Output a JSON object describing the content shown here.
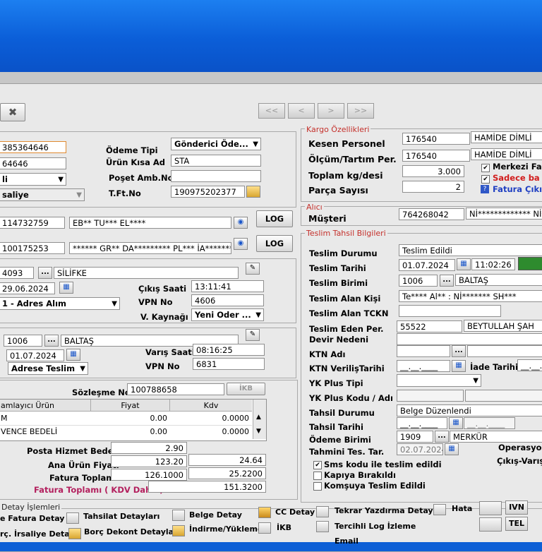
{
  "toolbar": {
    "close": "✖",
    "nav": [
      "<<",
      "<",
      ">",
      ">>"
    ]
  },
  "left": {
    "code_top": "385364646",
    "code2": "64646",
    "combo_li": "li",
    "combo_saliye": "saliye",
    "odeme_tipi_label": "Ödeme Tipi",
    "odeme_tipi_value": "Gönderici Öde...",
    "urun_kisa_ad_label": "Ürün Kısa Ad",
    "urun_kisa_ad_value": "STA",
    "poset_label": "Poşet Amb.No",
    "poset_value": "",
    "tft_label": "T.Ft.No",
    "tft_value": "190975202377",
    "sender_id": "114732759",
    "sender_name": "EB** TU*** EL****",
    "log1": "LOG",
    "recv_id": "100175253",
    "recv_name": "****** GR** DA********* PL*** İA********",
    "log2": "LOG",
    "origin_code": "4093",
    "origin_name": "SİLİFKE",
    "origin_date": "29.06.2024",
    "adres_alim": "1 - Adres Alım",
    "cikis_saati_label": "Çıkış Saati",
    "cikis_saati": "13:11:41",
    "vpn1_label": "VPN No",
    "vpn1": "4606",
    "vkaynagi_label": "V. Kaynağı",
    "vkaynagi": "Yeni Oder ...",
    "dest_code": "1006",
    "dest_name": "BALTAŞ",
    "dest_date": "01.07.2024",
    "varis_saati_label": "Varış Saati",
    "varis_saati": "08:16:25",
    "adrese_teslim": "Adrese Teslim",
    "vpn2_label": "VPN No",
    "vpn2": "6831",
    "sozlesme_label": "Sözleşme No",
    "sozlesme": "100788658",
    "ikb": "İKB",
    "table_headers": [
      "amlayıcı Ürün",
      "Fiyat",
      "Kdv"
    ],
    "rows": [
      {
        "name": "M",
        "fiyat": "0.00",
        "kdv": "0.0000"
      },
      {
        "name": "VENCE BEDELİ",
        "fiyat": "0.00",
        "kdv": "0.0000"
      }
    ],
    "posta_label": "Posta Hizmet Bedeli",
    "posta": "2.90",
    "ana_label": "Ana Ürün Fiyatı",
    "ana_fiyat": "123.20",
    "ana_kdv": "24.64",
    "fatura_label": "Fatura Toplamı",
    "fatura": "126.1000",
    "fatura_kdv": "25.2200",
    "fatura_kdv_label": "Fatura Toplamı ( KDV Dahil )",
    "fatura_kdv_total": "151.3200"
  },
  "kargo": {
    "title": "Kargo Özellikleri",
    "kesen_label": "Kesen Personel",
    "kesen_id": "176540",
    "kesen_name": "HAMİDE  DİMLİ",
    "olcum_label": "Ölçüm/Tartım Per.",
    "olcum_id": "176540",
    "olcum_name": "HAMİDE  DİMLİ",
    "toplam_label": "Toplam kg/desi",
    "toplam": "3.000",
    "parca_label": "Parça Sayısı",
    "parca": "2",
    "merkezi": "Merkezi Fa",
    "sadece": "Sadece ba",
    "fatura_cikis": "Fatura Çıkış"
  },
  "alici": {
    "title": "Alıcı",
    "musteri_label": "Müşteri",
    "musteri": "764268042",
    "name": "Nİ*************  Nİ**"
  },
  "teslim": {
    "title": "Teslim Tahsil Bilgileri",
    "durum_label": "Teslim Durumu",
    "durum": "Teslim Edildi",
    "tarih_label": "Teslim Tarihi",
    "tarih": "01.07.2024",
    "saat": "11:02:26",
    "birim_label": "Teslim Birimi",
    "birim_code": "1006",
    "birim_name": "BALTAŞ",
    "alan_label": "Teslim Alan Kişi",
    "alan": "Te**** Al** : Nİ******* SH***",
    "tckn_label": "Teslim Alan TCKN",
    "eden_label": "Teslim Eden Per.",
    "eden_id": "55522",
    "eden_name": "BEYTULLAH  ŞAH",
    "devir_label": "Devir Nedeni",
    "ktn_label": "KTN Adı",
    "ktn_tarih_label": "KTN VerilişTarihi",
    "iade_label": "İade Tarihi",
    "date_mask": "__.__.____",
    "yk_tipi_label": "YK Plus Tipi",
    "yk_kodu_label": "YK Plus Kodu / Adı",
    "tahsil_durum_label": "Tahsil Durumu",
    "tahsil_durum": "Belge Düzenlendi",
    "tahsil_tarih_label": "Tahsil Tarihi",
    "odeme_birimi_label": "Ödeme Birimi",
    "odeme_birimi_code": "1909",
    "odeme_birimi_name": "MERKÜR",
    "tahmini_label": "Tahmini Tes. Tar.",
    "tahmini": "02.07.2024",
    "operasyon": "Operasyon",
    "cikis_varis": "Çıkış-Varış",
    "sms": "Sms kodu ile teslim edildi",
    "kapiya": "Kapıya Bırakıldı",
    "komsuya": "Komşuya Teslim Edildi"
  },
  "detay": {
    "title": "Detay İşlemleri",
    "items": [
      "e Fatura Detay",
      "Tahsilat Detayları",
      "Belge Detay",
      "CC Detay",
      "Tekrar Yazdırma Detay",
      "Hata",
      "rç. İrsaliye Detay",
      "Borç Dekont Detayları",
      "İndirme/Yükleme",
      "İKB",
      "Tercihli Log İzleme",
      "Email"
    ],
    "ivn": "IVN",
    "tel": "TEL"
  }
}
